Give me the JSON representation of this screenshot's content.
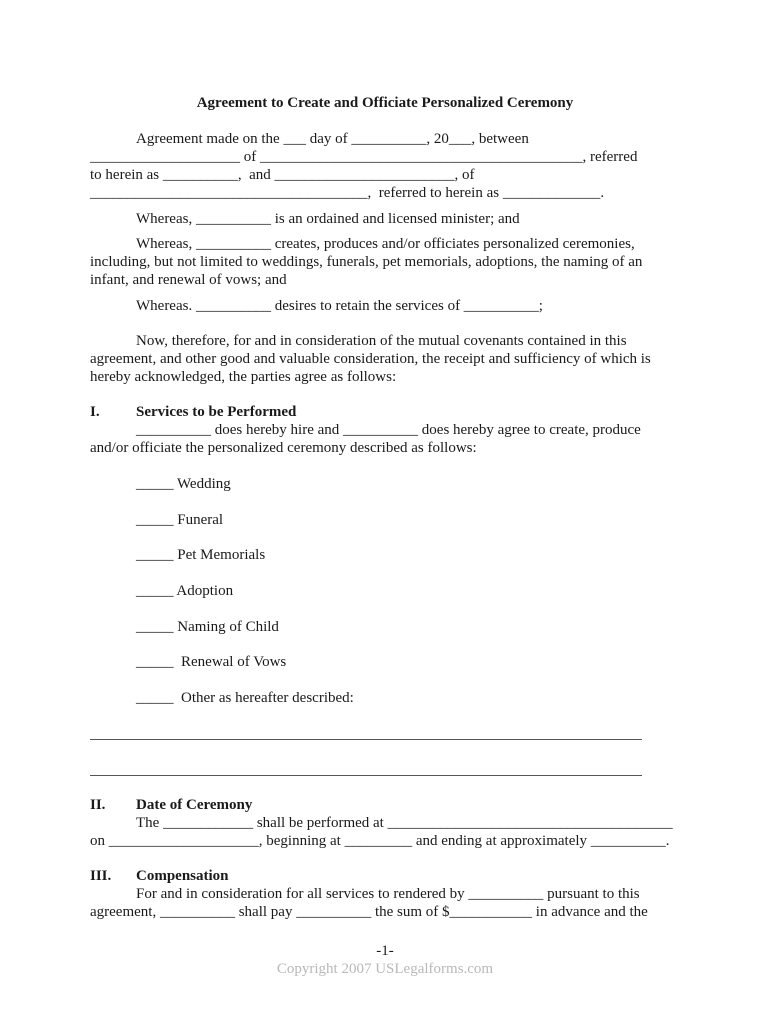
{
  "document": {
    "title": "Agreement to Create and Officiate Personalized Ceremony",
    "intro": [
      "Agreement made on the ___ day of __________, 20___, between",
      "____________________ of ___________________________________________, referred",
      "to herein as __________,  and ________________________, of",
      "_____________________________________,  referred to herein as _____________."
    ],
    "whereas": [
      "Whereas, __________ is an ordained and licensed minister; and",
      "Whereas, __________ creates, produces and/or officiates personalized ceremonies,",
      "including, but not limited to weddings, funerals, pet memorials, adoptions, the naming of an",
      "infant, and renewal of vows; and",
      "Whereas. __________ desires to retain the services of __________;"
    ],
    "now_therefore": [
      "Now, therefore, for and in consideration of the mutual covenants contained in this",
      "agreement, and other good and valuable consideration, the receipt and sufficiency of which is",
      "hereby acknowledged, the parties agree as follows:"
    ],
    "sections": [
      {
        "number": "I.",
        "heading": "Services to be Performed",
        "lines": [
          "__________ does hereby hire and __________ does hereby agree to create, produce",
          "and/or officiate the personalized ceremony described as follows:"
        ],
        "options": [
          "_____ Wedding",
          "_____ Funeral",
          "_____ Pet Memorials",
          "_____ Adoption",
          "_____ Naming of Child",
          "_____  Renewal of Vows",
          "_____  Other as hereafter described:"
        ]
      },
      {
        "number": "II.",
        "heading": "Date of Ceremony",
        "lines": [
          "The ____________ shall be performed at ______________________________________",
          "on ____________________, beginning at _________ and ending at approximately __________."
        ]
      },
      {
        "number": "III.",
        "heading": "Compensation",
        "lines": [
          "For and in consideration for all services to rendered by __________ pursuant to this",
          "agreement, __________ shall pay __________ the sum of $___________ in advance and the"
        ]
      }
    ],
    "footer": {
      "page_number": "-1-",
      "copyright": "Copyright 2007 USLegalforms.com"
    }
  }
}
